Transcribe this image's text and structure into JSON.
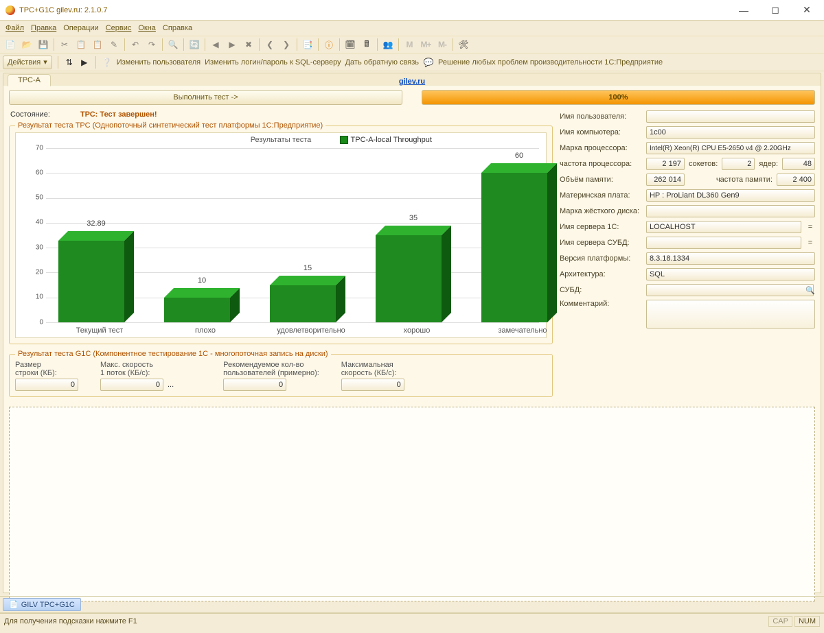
{
  "window": {
    "title": "TPC+G1C gilev.ru: 2.1.0.7"
  },
  "menu": {
    "file": "Файл",
    "edit": "Правка",
    "ops": "Операции",
    "service": "Сервис",
    "windows": "Окна",
    "help": "Справка"
  },
  "toolbar_m": {
    "m": "M",
    "mplus": "M+",
    "mminus": "M-"
  },
  "actions": {
    "dropdown": "Действия",
    "changeUser": "Изменить пользователя",
    "changeSQL": "Изменить логин/пароль к SQL-серверу",
    "feedback": "Дать обратную связь",
    "solve": "Решение любых проблем производительности 1С:Предприятие"
  },
  "tab": {
    "name": "TPC-A",
    "siteurl": "gilev.ru"
  },
  "run": {
    "button": "Выполнить тест ->",
    "progress": "100%"
  },
  "status": {
    "label": "Состояние:",
    "value": "ТРС: Тест завершен!"
  },
  "tpc": {
    "legend_title": "Результат теста ТРС (Однопоточный синтетический тест платформы 1С:Предприятие)",
    "chart_title": "Результаты теста",
    "series_name": "TPC-A-local Throughput"
  },
  "chart_data": {
    "type": "bar",
    "categories": [
      "Текущий тест",
      "плохо",
      "удовлетворительно",
      "хорошо",
      "замечательно"
    ],
    "values": [
      32.89,
      10,
      15,
      35,
      60
    ],
    "title": "Результаты теста",
    "series_name": "TPC-A-local Throughput",
    "xlabel": "",
    "ylabel": "",
    "ylim": [
      0,
      70
    ]
  },
  "g1c": {
    "legend_title": "Результат теста G1C (Компонентное тестирование 1С - многопоточная запись на диски)",
    "row_size_lbl": "Размер\nстроки (КБ):",
    "max_speed_lbl": "Макс. скорость\n1 поток (КБ/с):",
    "rec_users_lbl": "Рекомендуемое кол-во\nпользователей (примерно):",
    "max_speed2_lbl": "Максимальная\nскорость (КБ/с):",
    "row_size": "0",
    "max_speed1": "0",
    "ellipsis": "...",
    "rec_users": "0",
    "max_speed2": "0"
  },
  "form": {
    "user_lbl": "Имя пользователя:",
    "user": "",
    "pc_lbl": "Имя компьютера:",
    "pc": "1c00",
    "cpu_brand_lbl": "Марка процессора:",
    "cpu_brand": "Intel(R) Xeon(R) CPU E5-2650 v4 @ 2.20GHz",
    "cpu_freq_lbl": "частота процессора:",
    "cpu_freq": "2 197",
    "sockets_lbl": "сокетов:",
    "sockets": "2",
    "cores_lbl": "ядер:",
    "cores": "48",
    "ram_lbl": "Объём памяти:",
    "ram": "262 014",
    "ram_freq_lbl": "частота памяти:",
    "ram_freq": "2 400",
    "mb_lbl": "Материнская плата:",
    "mb": "HP : ProLiant DL360 Gen9",
    "hdd_lbl": "Марка жёсткого диска:",
    "hdd": "",
    "srv1c_lbl": "Имя сервера 1С:",
    "srv1c": "LOCALHOST",
    "srvdb_lbl": "Имя сервера СУБД:",
    "srvdb": "",
    "plat_lbl": "Версия платформы:",
    "plat": "8.3.18.1334",
    "arch_lbl": "Архитектура:",
    "arch": "SQL",
    "subd_lbl": "СУБД:",
    "subd": "",
    "comment_lbl": "Комментарий:",
    "eq": "="
  },
  "task": {
    "name": "GILV TPC+G1C"
  },
  "status_bar": {
    "hint": "Для получения подсказки нажмите F1",
    "cap": "CAP",
    "num": "NUM"
  }
}
